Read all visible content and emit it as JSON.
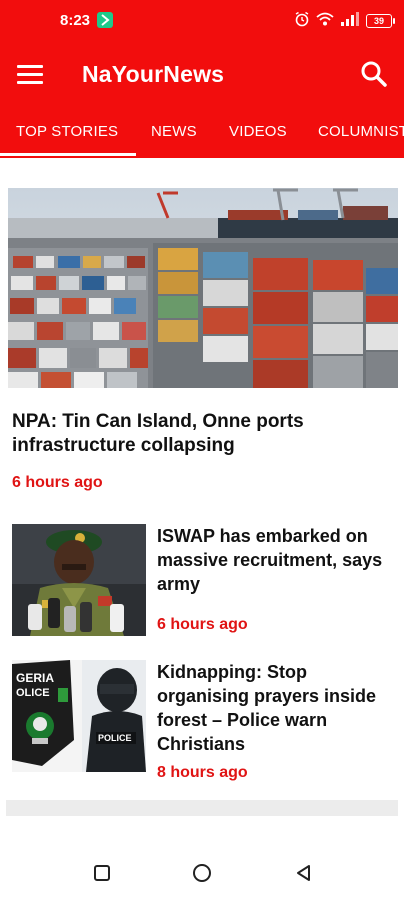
{
  "status_bar": {
    "time": "8:23",
    "battery": "39",
    "icons": [
      "alarm-icon",
      "wifi-icon",
      "signal-icon",
      "battery-icon"
    ]
  },
  "app_bar": {
    "title": "NaYourNews",
    "menu_icon": "hamburger-menu-icon",
    "search_icon": "search-icon",
    "color": "#f20d0d"
  },
  "tabs": [
    {
      "label": "TOP STORIES",
      "active": true
    },
    {
      "label": "NEWS",
      "active": false
    },
    {
      "label": "VIDEOS",
      "active": false
    },
    {
      "label": "COLUMNISTS",
      "active": false
    }
  ],
  "articles": [
    {
      "title": "NPA: Tin Can Island, Onne ports infrastructure collapsing",
      "time": "6 hours ago",
      "image": "shipping-containers-port-photo"
    },
    {
      "title": "ISWAP has embarked on massive recruitment, says army",
      "time": "6 hours ago",
      "image": "army-officer-speaking-photo"
    },
    {
      "title": "Kidnapping: Stop organising prayers inside forest – Police warn Christians",
      "time": "8 hours ago",
      "image": "nigeria-police-badge-photo"
    }
  ],
  "badge_text": {
    "police_patch": "GERIA POLICE",
    "police_vest": "POLICE"
  },
  "accent_time_color": "#e01414",
  "nav_bar": {
    "buttons": [
      "recent-apps-square-icon",
      "home-circle-icon",
      "back-triangle-icon"
    ]
  }
}
